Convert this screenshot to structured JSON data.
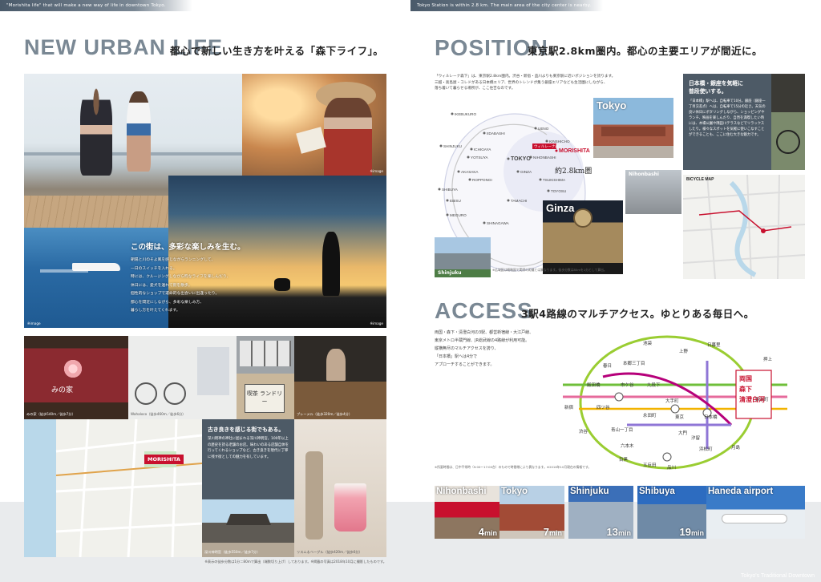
{
  "left": {
    "top_strip": "\"Morishita life\" that will make a new way of life in downtown Tokyo.",
    "heading_en": "NEW URBAN LIFE",
    "heading_jp": "都心で新しい生き方を叶える「森下ライフ」。",
    "hero_copy_title": "この街は、多彩な楽しみを生む。",
    "hero_copy_body": [
      "朝陽と川のそよ風を感じながらランニングして、",
      "一日のスイッチを入れる。",
      "時には、クルージングしながら粋なライフを楽しんだり、",
      "休日には、愛犬を連れて街を散歩。",
      "個性的なショップで運命的な出会いに出逢ったり。",
      "都心を間近にしながら、多彩な楽しみ方、",
      "暮らし方を叶えてくれます。"
    ],
    "credit_image": "※image",
    "shop_caption_1": "みの家（徒歩540m／徒歩7分）",
    "shop_caption_2": "Wahaloco（徒歩460m／徒歩6分）",
    "shop_caption_3": "ブレーメル（徒歩320m／徒歩4分）",
    "noren_text": "みの家",
    "cafe_sign": "喫茶 ランドリー",
    "old_town_title": "古き良きを感じる街でもある。",
    "old_town_body": [
      "深川明神の神社に囲まれる深川神明宮。100年以上の歴史を誇る老舗のお店。味わいのある店舗自体を行ってくれるショップなど、古き良きを現代に丁寧に残す街としての魅力を有しています。"
    ],
    "map_badge": "MORISHITA",
    "shrine_caption": "深川神明宮（徒歩550m／徒歩7分）",
    "drink_caption": "リスム＆ベーグル（徒歩420m／徒歩6分）",
    "footnote": "※表示の徒歩分数は1分＝80mで算出（端数切り上げ）しております。※掲載の写真は2018年10月に撮影したものです。"
  },
  "right": {
    "top_strip": "Tokyo Station is within 2.8 km. The main area of the city center is nearby.",
    "heading_en": "POSITION",
    "heading_jp": "東京駅2.8km圏内。都心の主要エリアが間近に。",
    "position_body": [
      "「ウィルレーナ森下」は、東京駅2.8km圏内。渋谷・新宿・品川よりも東京駅に近いポジションを誇ります。",
      "三越・高島屋・コレドがある日本橋エリア、世界のトレンドが集う銀座エリアなども生活圏にしながら、",
      "落ち着いて暮らせる場所が、ここ住吉なのです。"
    ],
    "map_stations": [
      "IKEBUKURO",
      "UENO",
      "IIDABASHI",
      "KINSHICHO",
      "SHINJUKU",
      "ICHIGAYA",
      "YOTSUYA",
      "NIHONBASHI",
      "TOKYO",
      "MORISHITA",
      "AKASAKA",
      "ROPPONGI",
      "GINZA",
      "TSUKISHIMA",
      "SHIBUYA",
      "TAMACHI",
      "TOYOSU",
      "EBISU",
      "MEGURO",
      "SHINAGAWA"
    ],
    "map_pin_label": "ウィルレーナ森下",
    "radius_label": "約2.8km圏",
    "tag_tokyo": "Tokyo",
    "tag_ginza": "Ginza",
    "tag_nihonbashi": "Nihonbashi",
    "tag_shinjuku": "Shinjuku",
    "map_note": "※広域図は概略図で実際の距離とは異なります。徒歩分数は80mを1分として算出。",
    "nihonbashi_title": [
      "日本橋・銀座を気軽に",
      "普段使いする。"
    ],
    "nihonbashi_body": [
      "「日本橋」駅へは、自転車で10分。銀座（銀座一丁目交差点）へは、自転車で15分の近さ。天気の良い休日にポタリングしながら、ショッピングやランチ、映画を楽しんだり、自然を満喫したい時には、木場公園や隅田川テラスなどでリラックスしたり。様々なスポットを気軽に使いこなすことができることも、ここに住む大きな魅力です。"
    ],
    "bicycle_map": "BICYCLE MAP",
    "access_en": "ACCESS",
    "access_jp": "3駅4路線のマルチアクセス。ゆとりある毎日へ。",
    "access_body": [
      "両国・森下・清澄白河の3駅、都営新宿線・大江戸線、",
      "東京メトロ半蔵門線、JR総武線の4路線が利用可能。",
      "縦横無尽のマルチアクセスを誇り、",
      "「日本橋」駅へは4分で",
      "アプローチすることができます。"
    ],
    "route_stations": [
      "池袋",
      "上野",
      "日暮里",
      "春日",
      "本郷三丁目",
      "飯田橋",
      "市ケ谷",
      "九段下",
      "新宿",
      "四ツ谷",
      "永田町",
      "東京",
      "大手町",
      "日本橋",
      "両国",
      "森下",
      "清澄白河",
      "渋谷",
      "青山一丁目",
      "六本木",
      "汐留",
      "大門",
      "品川",
      "浜松町",
      "月島",
      "押上",
      "錦糸町",
      "五反田",
      "目黒"
    ],
    "home_stations": [
      "両国",
      "森下",
      "清澄白河"
    ],
    "route_note": "※所要時間は、日中平常時（9:00～17:00台）のもので時間帯により異なります。※2018年10月現在の情報です。",
    "stations": [
      {
        "name": "Nihonbashi",
        "time": "4",
        "unit": "min"
      },
      {
        "name": "Tokyo",
        "time": "7",
        "unit": "min"
      },
      {
        "name": "Shinjuku",
        "time": "13",
        "unit": "min"
      },
      {
        "name": "Shibuya",
        "time": "19",
        "unit": "min"
      },
      {
        "name": "Haneda airport",
        "time": "",
        "unit": ""
      }
    ],
    "bottom_tag": "Tokyo's Traditional Downtown"
  },
  "colors": {
    "heading_gray": "#7a8894",
    "accent_red": "#c8102e",
    "band_gray": "#e9ebed"
  }
}
